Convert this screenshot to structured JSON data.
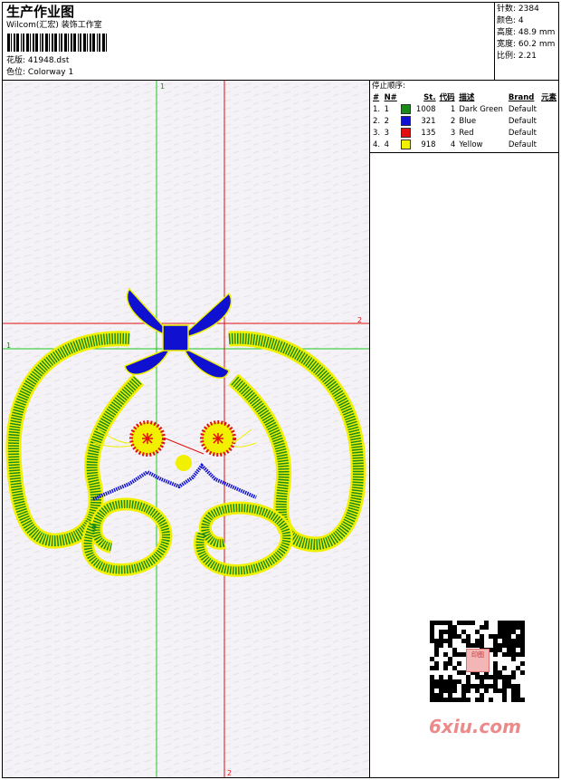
{
  "header": {
    "title": "生产作业图",
    "software": "Wilcom(汇宏) 装饰工作室",
    "design_label": "花版:",
    "design_file": "41948.dst",
    "colorway_label": "色位:",
    "colorway": "Colorway 1"
  },
  "stats": {
    "stitches_label": "针数:",
    "stitches": "2384",
    "colors_label": "颜色:",
    "colors": "4",
    "height_label": "高度:",
    "height": "48.9 mm",
    "width_label": "宽度:",
    "width": "60.2 mm",
    "ratio_label": "比例:",
    "ratio": "2.21"
  },
  "stop_sequence": {
    "title": "停止顺序:",
    "headers": [
      "#",
      "N#",
      "St.",
      "代码",
      "描述",
      "Brand",
      "元素"
    ],
    "rows": [
      {
        "num": "1.",
        "n": "1",
        "color": "#1a8a1a",
        "stitches": "1008",
        "code": "1",
        "desc": "Dark Green",
        "brand": "Default"
      },
      {
        "num": "2.",
        "n": "2",
        "color": "#1010d0",
        "stitches": "321",
        "code": "2",
        "desc": "Blue",
        "brand": "Default"
      },
      {
        "num": "3.",
        "n": "3",
        "color": "#e01010",
        "stitches": "135",
        "code": "3",
        "desc": "Red",
        "brand": "Default"
      },
      {
        "num": "4.",
        "n": "4",
        "color": "#f0f000",
        "stitches": "918",
        "code": "4",
        "desc": "Yellow",
        "brand": "Default"
      }
    ]
  },
  "canvas": {
    "guide_1_top": "1",
    "guide_1_left": "1",
    "guide_2_right": "2",
    "guide_2_bottom": "2"
  },
  "watermark": {
    "text": "6xiu.com",
    "qr_stamp": "印图"
  }
}
